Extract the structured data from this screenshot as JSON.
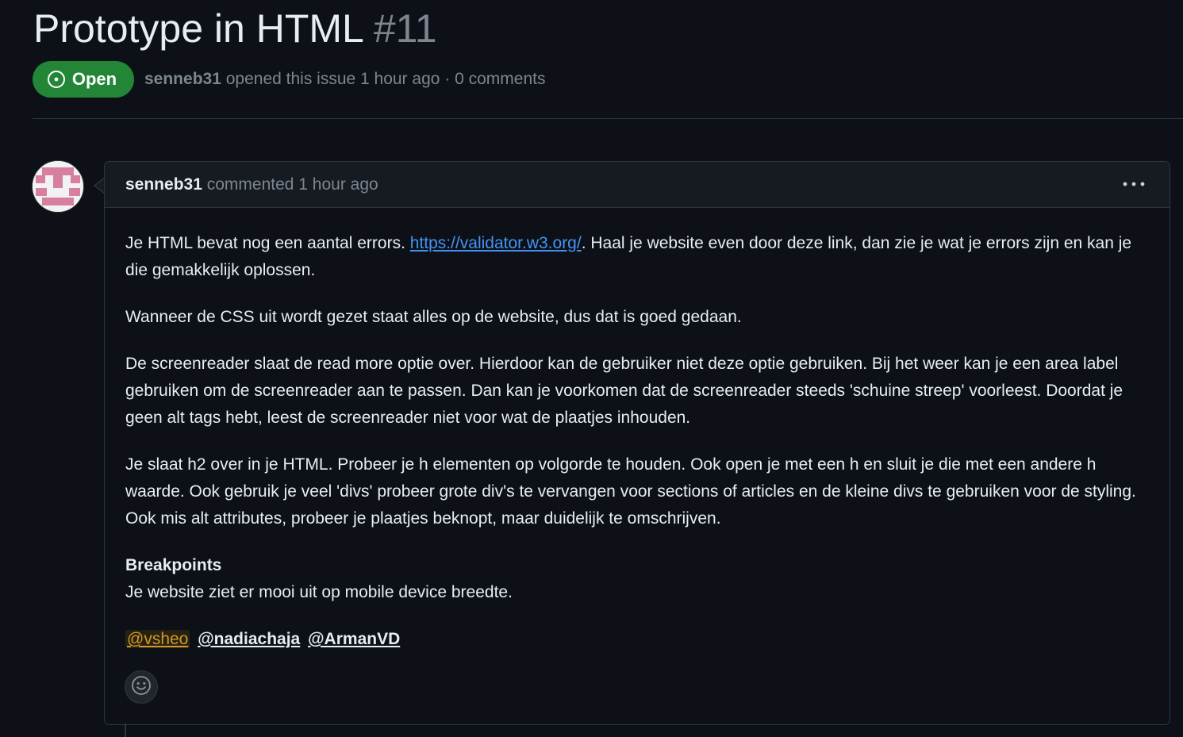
{
  "issue": {
    "title": "Prototype in HTML",
    "number": "#11",
    "state": "Open",
    "author": "senneb31",
    "meta_action": " opened this issue 1 hour ago · 0 comments"
  },
  "comment": {
    "author": "senneb31",
    "action": " commented 1 hour ago",
    "p1_before": "Je HTML bevat nog een aantal errors. ",
    "p1_link": "https://validator.w3.org/",
    "p1_after": ". Haal je website even door deze link, dan zie je wat je errors zijn en kan je die gemakkelijk oplossen.",
    "p2": "Wanneer de CSS uit wordt gezet staat alles op de website, dus dat is goed gedaan.",
    "p3": "De screenreader slaat de read more optie over. Hierdoor kan de gebruiker niet deze optie gebruiken. Bij het weer kan je een area label gebruiken om de screenreader aan te passen. Dan kan je voorkomen dat de screenreader steeds 'schuine streep' voorleest. Doordat je geen alt tags hebt, leest de screenreader niet voor wat de plaatjes inhouden.",
    "p4": "Je slaat h2 over in je HTML. Probeer je h elementen op volgorde te houden. Ook open je met een h en sluit je die met een andere h waarde. Ook gebruik je veel 'divs' probeer grote div's te vervangen voor sections of articles en de kleine divs te gebruiken voor de styling. Ook mis alt attributes, probeer je plaatjes beknopt, maar duidelijk te omschrijven.",
    "p5_heading": "Breakpoints",
    "p5_text": "Je website ziet er mooi uit op mobile device breedte.",
    "mentions": [
      "@vsheo",
      "@nadiachaja",
      "@ArmanVD"
    ]
  },
  "icons": {
    "state": "issue-opened-icon",
    "menu": "kebab-horizontal-icon",
    "reaction": "smiley-icon"
  },
  "colors": {
    "background": "#0d1117",
    "open_green": "#238636",
    "link_blue": "#4493f8",
    "self_mention": "#d29922",
    "avatar_pink": "#d77fa1"
  }
}
